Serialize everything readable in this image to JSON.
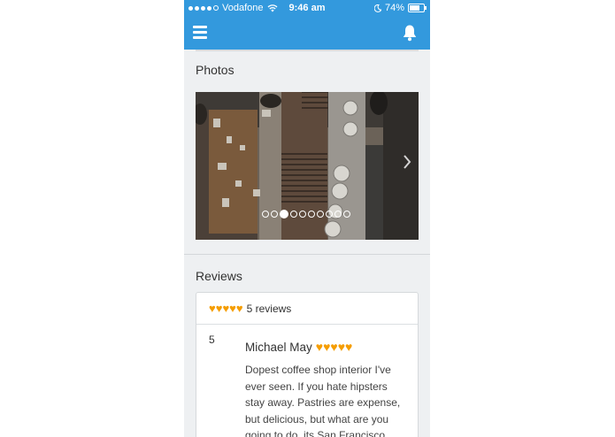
{
  "status": {
    "carrier": "Vodafone",
    "time": "9:46 am",
    "battery": "74%",
    "battery_level": 0.74
  },
  "photos": {
    "title": "Photos",
    "page_count": 10,
    "active_index": 2
  },
  "reviews": {
    "title": "Reviews",
    "summary_hearts": "♥♥♥♥♥",
    "summary_count": "5 reviews",
    "items": [
      {
        "score": "5",
        "author": "Michael May",
        "hearts": "♥♥♥♥♥",
        "text": "Dopest coffee shop interior I've ever seen. If you hate hipsters stay away. Pastries are expense, but delicious, but what are you going to do, its San Francisco."
      }
    ]
  },
  "colors": {
    "accent": "#3399dd",
    "heart": "#f59d00",
    "background": "#eef0f2"
  }
}
